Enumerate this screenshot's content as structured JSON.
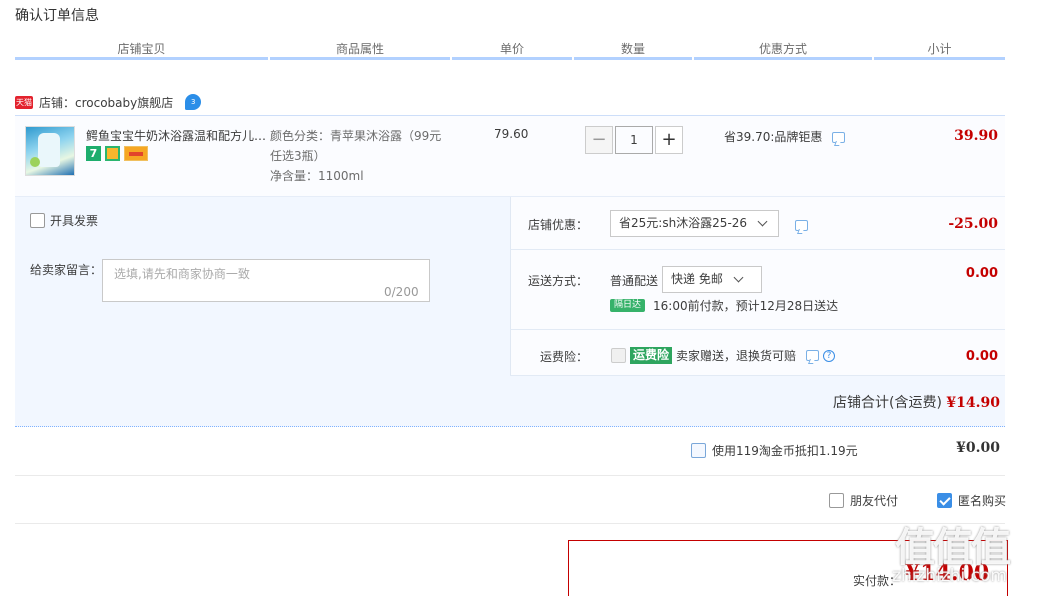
{
  "page": {
    "title": "确认订单信息"
  },
  "columns": [
    "店铺宝贝",
    "商品属性",
    "单价",
    "数量",
    "优惠方式",
    "小计"
  ],
  "shop": {
    "badge": "天猫",
    "label": "店铺：crocobaby旗舰店",
    "ww_badge": "3"
  },
  "item": {
    "title": "鳄鱼宝宝牛奶沐浴露温和配方儿…",
    "badge_7": "7",
    "attr_color": "颜色分类：青苹果沐浴露（99元",
    "attr_color_cont": "任选3瓶）",
    "attr_volume": "净含量：1100ml",
    "unit_price": "79.60",
    "qty_minus": "−",
    "qty": "1",
    "qty_plus": "+",
    "promo": "省39.70:品牌钜惠",
    "subtotal": "39.90"
  },
  "invoice": {
    "label": "开具发票"
  },
  "message": {
    "label": "给卖家留言：",
    "placeholder": "选填,请先和商家协商一致",
    "counter": "0/200"
  },
  "store_discount": {
    "label": "店铺优惠：",
    "selected": "省25元:sh沐浴露25-26",
    "amount": "-25.00"
  },
  "shipping": {
    "label": "运送方式：",
    "method": "普通配送",
    "selected": "快递 免邮",
    "amount": "0.00",
    "badge": "隔日达",
    "eta": "16:00前付款，预计12月28日送达"
  },
  "insurance": {
    "label": "运费险：",
    "badge": "运费险",
    "text": "卖家赠送，退换货可赔",
    "amount": "0.00"
  },
  "store_total": {
    "label": "店铺合计(含运费)",
    "amount": "¥14.90"
  },
  "coins": {
    "label": "使用119淘金币抵扣1.19元",
    "amount": "¥0.00"
  },
  "friend_pay": {
    "label": "朋友代付",
    "checked": false
  },
  "anonymous": {
    "label": "匿名购买",
    "checked": true
  },
  "payment": {
    "label": "实付款：",
    "amount": "¥14.00"
  },
  "watermark": {
    "text": "值值值",
    "url": "zhizhizhi.com"
  }
}
